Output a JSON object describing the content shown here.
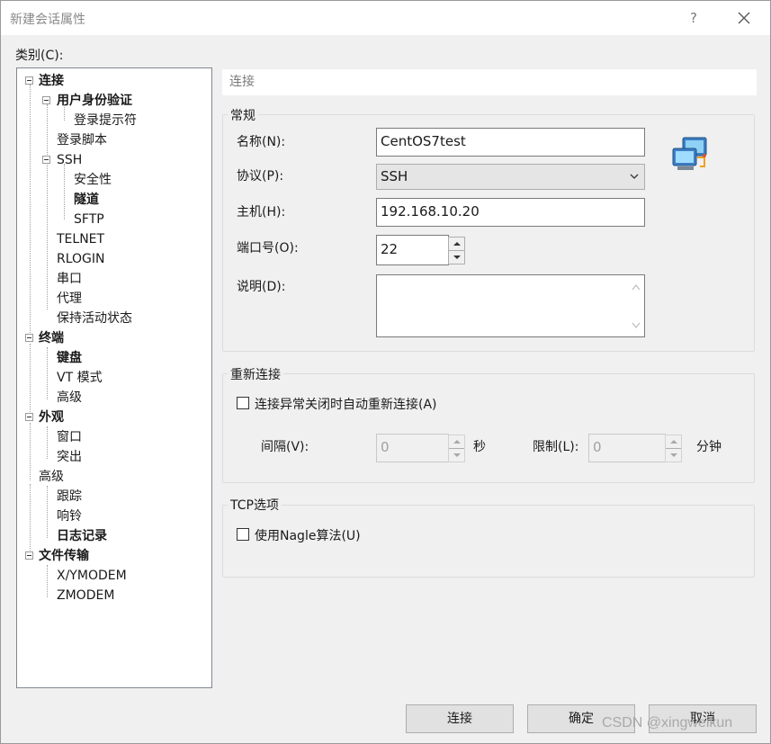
{
  "window": {
    "title": "新建会话属性",
    "help_glyph": "?"
  },
  "category_label": "类别(C):",
  "tree": [
    {
      "label": "连接",
      "bold": true
    },
    {
      "label": "用户身份验证",
      "bold": true
    },
    {
      "label": "登录提示符",
      "bold": false
    },
    {
      "label": "登录脚本",
      "bold": false
    },
    {
      "label": "SSH",
      "bold": false
    },
    {
      "label": "安全性",
      "bold": false
    },
    {
      "label": "隧道",
      "bold": true
    },
    {
      "label": "SFTP",
      "bold": false
    },
    {
      "label": "TELNET",
      "bold": false
    },
    {
      "label": "RLOGIN",
      "bold": false
    },
    {
      "label": "串口",
      "bold": false
    },
    {
      "label": "代理",
      "bold": false
    },
    {
      "label": "保持活动状态",
      "bold": false
    },
    {
      "label": "终端",
      "bold": true
    },
    {
      "label": "键盘",
      "bold": true
    },
    {
      "label": "VT 模式",
      "bold": false
    },
    {
      "label": "高级",
      "bold": false
    },
    {
      "label": "外观",
      "bold": true
    },
    {
      "label": "窗口",
      "bold": false
    },
    {
      "label": "突出",
      "bold": false
    },
    {
      "label": "高级",
      "bold": false
    },
    {
      "label": "跟踪",
      "bold": false
    },
    {
      "label": "响铃",
      "bold": false
    },
    {
      "label": "日志记录",
      "bold": true
    },
    {
      "label": "文件传输",
      "bold": true
    },
    {
      "label": "X/YMODEM",
      "bold": false
    },
    {
      "label": "ZMODEM",
      "bold": false
    }
  ],
  "panel": {
    "header": "连接",
    "general": {
      "title": "常规",
      "name_label": "名称(N):",
      "name_value": "CentOS7test",
      "protocol_label": "协议(P):",
      "protocol_value": "SSH",
      "host_label": "主机(H):",
      "host_value": "192.168.10.20",
      "port_label": "端口号(O):",
      "port_value": "22",
      "desc_label": "说明(D):",
      "desc_value": ""
    },
    "reconnect": {
      "title": "重新连接",
      "auto_label": "连接异常关闭时自动重新连接(A)",
      "auto_checked": false,
      "interval_label": "间隔(V):",
      "interval_value": "0",
      "interval_unit": "秒",
      "limit_label": "限制(L):",
      "limit_value": "0",
      "limit_unit": "分钟"
    },
    "tcp": {
      "title": "TCP选项",
      "nagle_label": "使用Nagle算法(U)",
      "nagle_checked": false
    }
  },
  "buttons": {
    "connect": "连接",
    "ok": "确定",
    "cancel": "取消"
  },
  "watermark": "CSDN @xingweikun"
}
